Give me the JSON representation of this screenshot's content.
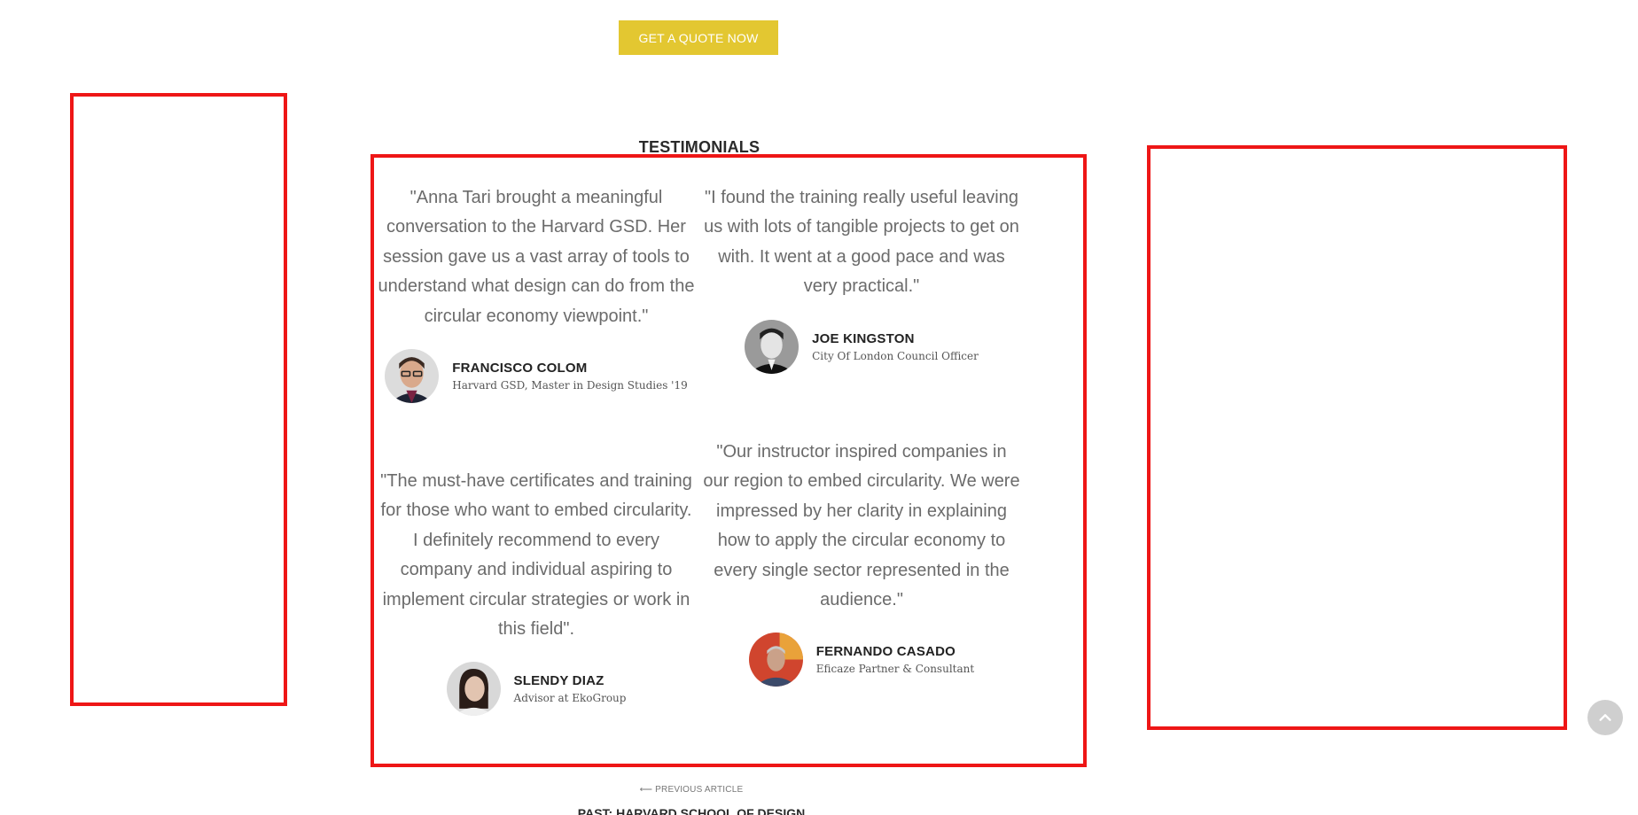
{
  "cta": {
    "label": "GET A QUOTE NOW",
    "color": "#e3c731"
  },
  "section": {
    "title": "TESTIMONIALS"
  },
  "highlight_color": "#ee1616",
  "testimonials": [
    {
      "quote": "\"Anna Tari brought a meaningful conversation to the Harvard GSD. Her session gave us a vast array of tools to understand what design can do from the circular economy viewpoint.\"",
      "name": "FRANCISCO COLOM",
      "role": "Harvard GSD, Master in Design Studies '19",
      "avatar": "francisco-avatar"
    },
    {
      "quote": "\"I found the training really useful leaving us with lots of tangible projects to get on with. It went at a good pace and was very practical.\"",
      "name": "JOE KINGSTON",
      "role": "City Of London Council Officer",
      "avatar": "joe-avatar"
    },
    {
      "quote": "\"The must-have certificates and training for those who want to embed circularity. I definitely recommend to every company and individual aspiring to implement circular strategies or work in this field\".",
      "name": "SLENDY DIAZ",
      "role": "Advisor at EkoGroup",
      "avatar": "slendy-avatar"
    },
    {
      "quote": "\"Our instructor inspired companies in our region to embed circularity. We were impressed by her clarity in explaining how to apply the circular economy to every single sector represented in the audience.\"",
      "name": "FERNANDO CASADO",
      "role": "Eficaze Partner & Consultant",
      "avatar": "fernando-avatar"
    }
  ],
  "previous_article": {
    "label": "PREVIOUS ARTICLE",
    "arrow_icon": "arrow-left-icon",
    "title": "PAST: HARVARD SCHOOL OF DESIGN"
  },
  "scroll_top": {
    "icon": "chevron-up-icon"
  }
}
